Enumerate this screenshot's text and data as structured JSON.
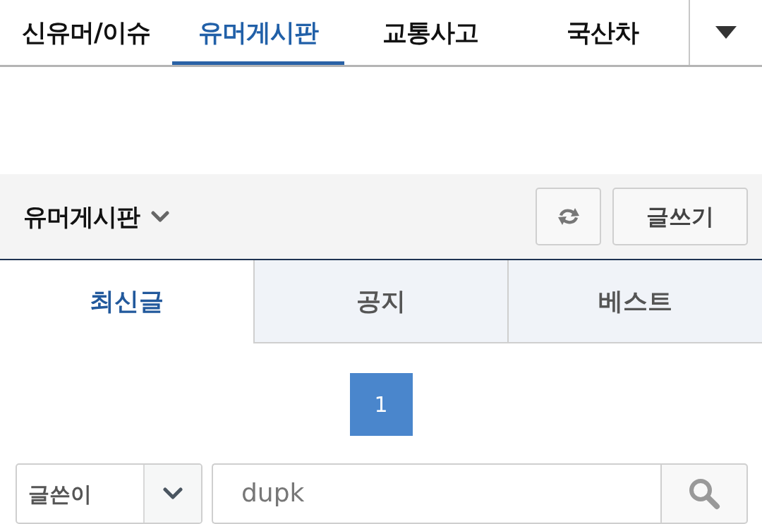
{
  "nav": {
    "tabs": [
      {
        "label": "신유머/이슈",
        "selected": false
      },
      {
        "label": "유머게시판",
        "selected": true
      },
      {
        "label": "교통사고",
        "selected": false
      },
      {
        "label": "국산차",
        "selected": false
      }
    ]
  },
  "board_header": {
    "title": "유머게시판",
    "write_button": "글쓰기"
  },
  "list_tabs": [
    {
      "label": "최신글",
      "selected": true
    },
    {
      "label": "공지",
      "selected": false
    },
    {
      "label": "베스트",
      "selected": false
    }
  ],
  "pagination": {
    "pages": [
      {
        "label": "1",
        "selected": true
      }
    ]
  },
  "search": {
    "field": "글쓴이",
    "query": "dupk"
  }
}
